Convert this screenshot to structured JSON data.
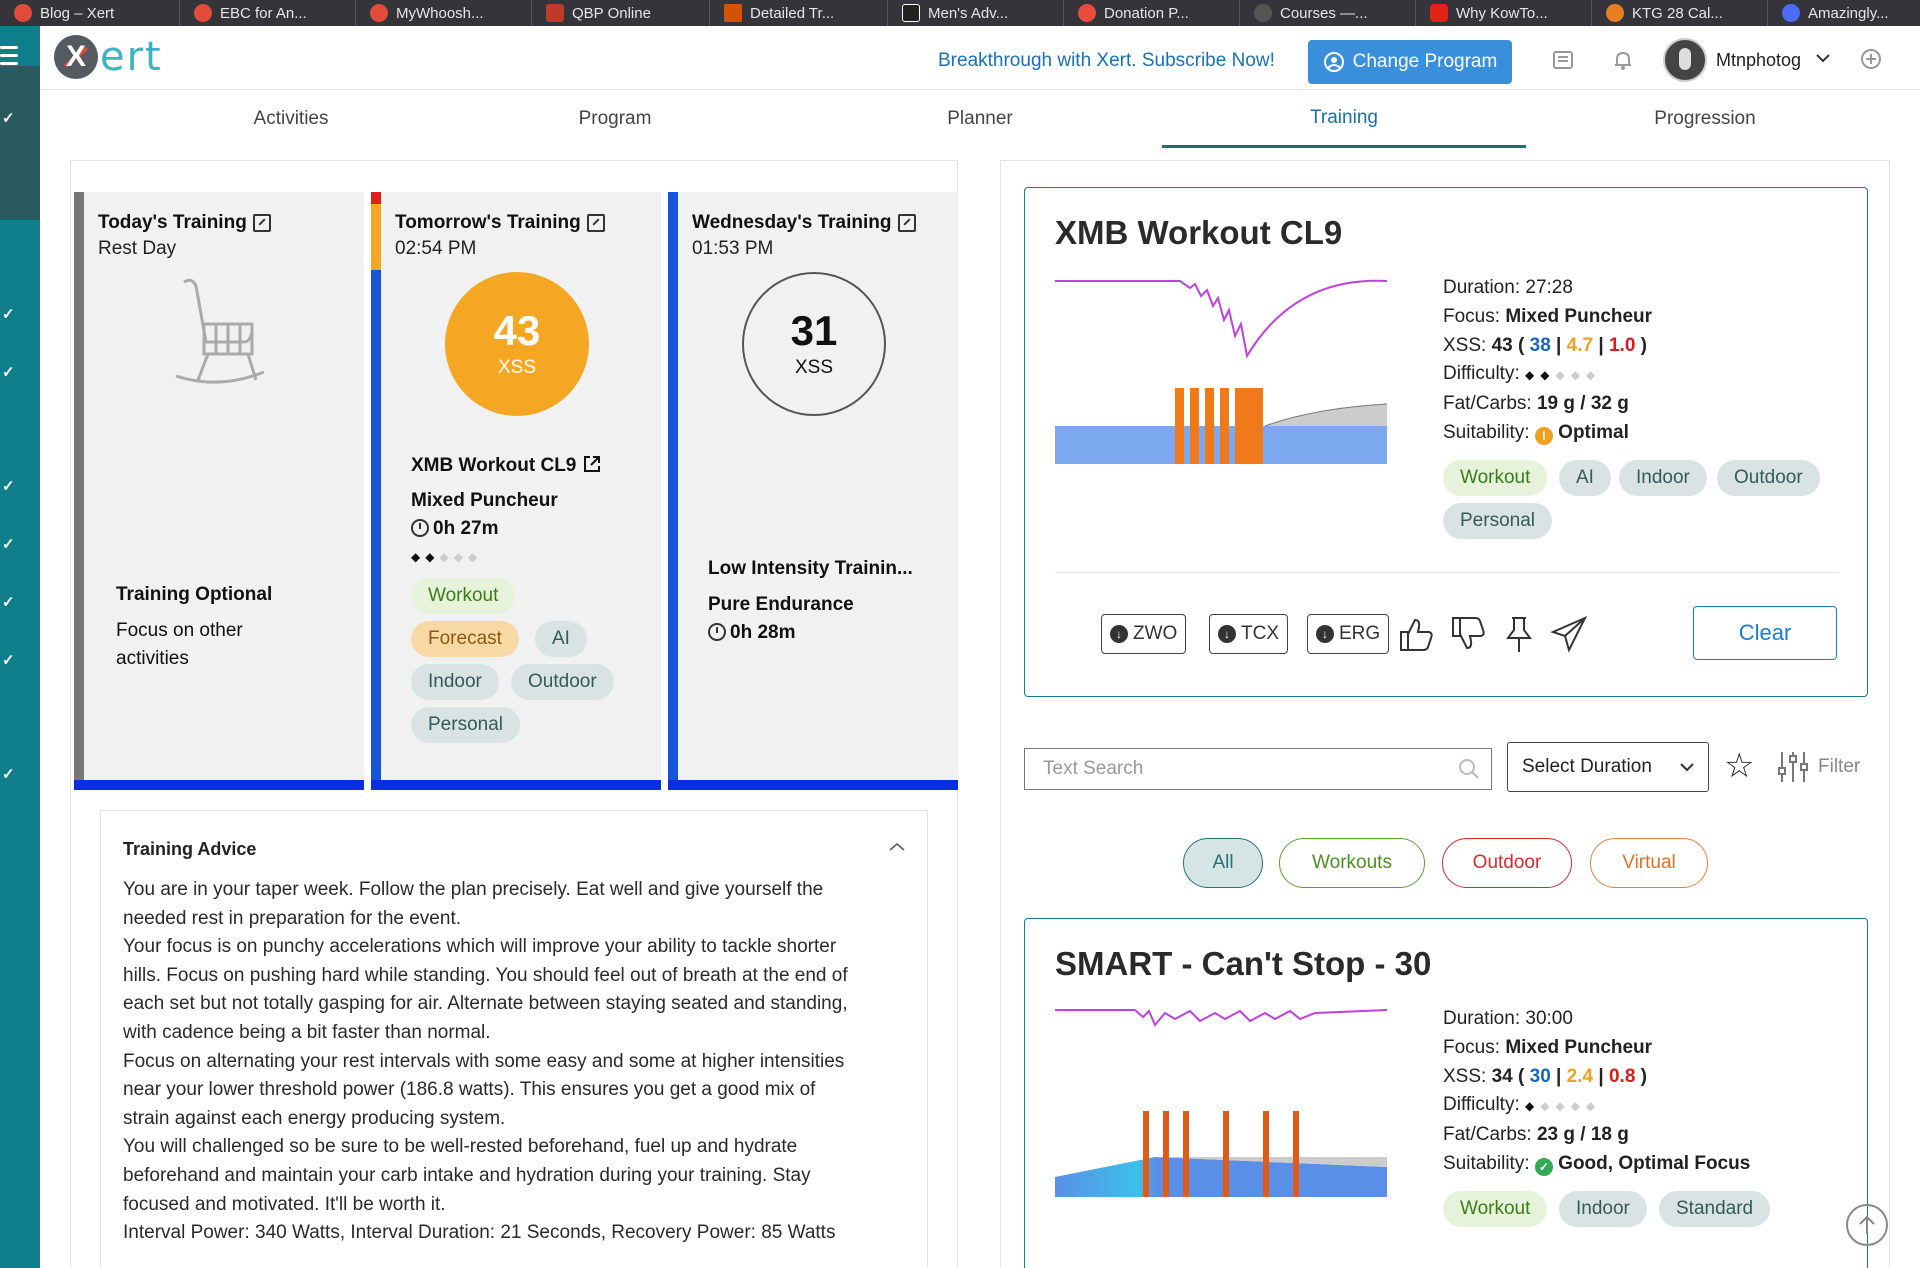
{
  "browser": {
    "bookmarks": [
      {
        "label": "Blog – Xert",
        "color": "#e24b3b"
      },
      {
        "label": "EBC for An...",
        "color": "#e24b3b"
      },
      {
        "label": "MyWhoosh...",
        "color": "#e24b3b"
      },
      {
        "label": "QBP Online",
        "color": "#c0392b"
      },
      {
        "label": "Detailed Tr...",
        "color": "#d35400"
      },
      {
        "label": "Men's Adv...",
        "color": "#222222"
      },
      {
        "label": "Donation P...",
        "color": "#e74c3c"
      },
      {
        "label": "Courses —...",
        "color": "#555555"
      },
      {
        "label": "Why KowTo...",
        "color": "#e62117"
      },
      {
        "label": "KTG 28 Cal...",
        "color": "#e67e22"
      },
      {
        "label": "Amazingly...",
        "color": "#4a6cf7"
      }
    ]
  },
  "header": {
    "logo_letter": "X",
    "logo_text": "ert",
    "promo": "Breakthrough with Xert. Subscribe Now!",
    "change_program": "Change Program",
    "username": "Mtnphotog"
  },
  "tabs": [
    "Activities",
    "Program",
    "Planner",
    "Training",
    "Progression"
  ],
  "active_tab": "Training",
  "days": [
    {
      "title": "Today's Training",
      "subtitle": "Rest Day",
      "headline": "Training Optional",
      "desc_line1": "Focus on other",
      "desc_line2": "activities"
    },
    {
      "title": "Tomorrow's Training",
      "subtitle": "02:54 PM",
      "xss": "43",
      "xss_label": "XSS",
      "workout": "XMB Workout CL9",
      "focus": "Mixed Puncheur",
      "duration": "0h 27m",
      "difficulty": 2,
      "tags": [
        "Workout",
        "Forecast",
        "AI",
        "Indoor",
        "Outdoor",
        "Personal"
      ]
    },
    {
      "title": "Wednesday's Training",
      "subtitle": "01:53 PM",
      "xss": "31",
      "xss_label": "XSS",
      "workout": "Low Intensity Trainin...",
      "focus": "Pure Endurance",
      "duration": "0h 28m"
    }
  ],
  "advice": {
    "title": "Training Advice",
    "lines": [
      "You are in your taper week. Follow the plan precisely. Eat well and give yourself the",
      "needed rest in preparation for the event.",
      "Your focus is on punchy accelerations which will improve your ability to tackle shorter",
      "hills. Focus on pushing hard while standing. You should feel out of breath at the end of",
      "each set but not totally gasping for air. Alternate between staying seated and standing,",
      "with cadence being a bit faster than normal.",
      "Focus on alternating your rest intervals with some easy and some at higher intensities",
      "near your lower threshold power (186.8 watts). This ensures you get a good mix of",
      "strain against each energy producing system.",
      "You will challenged so be sure to be well-rested beforehand, fuel up and hydrate",
      "beforehand and maintain your carb intake and hydration during your training. Stay",
      "focused and motivated. It'll be worth it.",
      "Interval Power: 340 Watts, Interval Duration: 21 Seconds, Recovery Power: 85 Watts"
    ]
  },
  "featured_workout": {
    "title": "XMB Workout CL9",
    "duration_label": "Duration:",
    "duration": "27:28",
    "focus_label": "Focus:",
    "focus": "Mixed Puncheur",
    "xss_label": "XSS:",
    "xss": "43",
    "xss_low": "38",
    "xss_high": "4.7",
    "xss_peak": "1.0",
    "difficulty_label": "Difficulty:",
    "fat_carbs_label": "Fat/Carbs:",
    "fat_carbs": "19 g / 32 g",
    "suitability_label": "Suitability:",
    "suitability": "Optimal",
    "tags": [
      "Workout",
      "AI",
      "Indoor",
      "Outdoor",
      "Personal"
    ],
    "downloads": [
      "ZWO",
      "TCX",
      "ERG"
    ],
    "clear": "Clear"
  },
  "search": {
    "placeholder": "Text Search",
    "duration_select": "Select Duration",
    "filter": "Filter"
  },
  "filters": [
    "All",
    "Workouts",
    "Outdoor",
    "Virtual"
  ],
  "second_workout": {
    "title": "SMART - Can't Stop - 30",
    "duration_label": "Duration:",
    "duration": "30:00",
    "focus_label": "Focus:",
    "focus": "Mixed Puncheur",
    "xss_label": "XSS:",
    "xss": "34",
    "xss_low": "30",
    "xss_high": "2.4",
    "xss_peak": "0.8",
    "difficulty_label": "Difficulty:",
    "fat_carbs_label": "Fat/Carbs:",
    "fat_carbs": "23 g / 18 g",
    "suitability_label": "Suitability:",
    "suitability": "Good, Optimal Focus",
    "tags": [
      "Workout",
      "Indoor",
      "Standard"
    ]
  },
  "colors": {
    "teal": "#0f7f8c",
    "xss_orange": "#f5a623",
    "blue_bar": "#0b2ee0",
    "accent_blue": "#1a70b8"
  }
}
